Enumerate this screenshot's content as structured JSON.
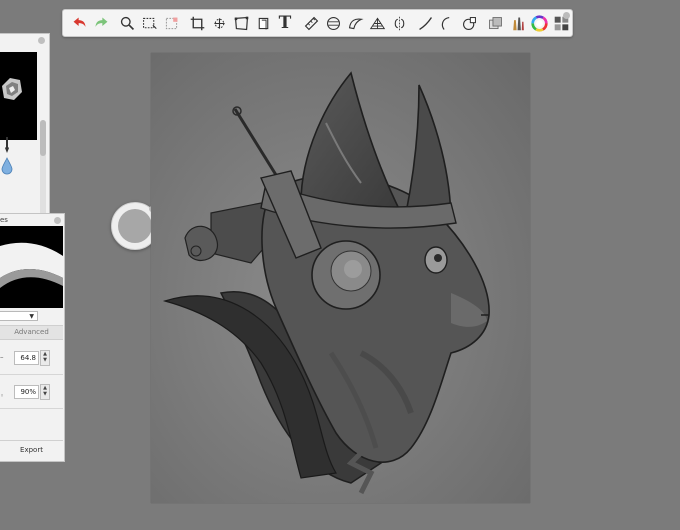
{
  "toolbar": {
    "tools": [
      "undo-icon",
      "redo-icon",
      "magnifier-icon",
      "rect-select-icon",
      "lasso-select-icon",
      "crop-icon",
      "transform-icon",
      "distort-icon",
      "layer-stack-icon",
      "text-tool-icon",
      "ruler-icon",
      "ellipse-guide-icon",
      "french-curve-icon",
      "perspective-grid-icon",
      "symmetry-icon",
      "stroke-icon",
      "curve-tool-icon",
      "shape-icon",
      "layer-icon",
      "brush-library-icon",
      "color-wheel-icon",
      "swatches-icon"
    ],
    "text_tool_glyph": "T"
  },
  "brush_panel": {
    "tools": [
      "pen-icon",
      "droplet-icon"
    ]
  },
  "curves_panel": {
    "title": "es",
    "tab_label": "Advanced",
    "field_1_value": "64.8",
    "field_2_value": "90%",
    "export_label": "Export"
  },
  "colors": {
    "workspace": "#7b7b7b",
    "panel": "#f2f2f2",
    "undo": "#d8382f",
    "redo": "#7cc47a",
    "current_brush": "#a7a7a7"
  }
}
